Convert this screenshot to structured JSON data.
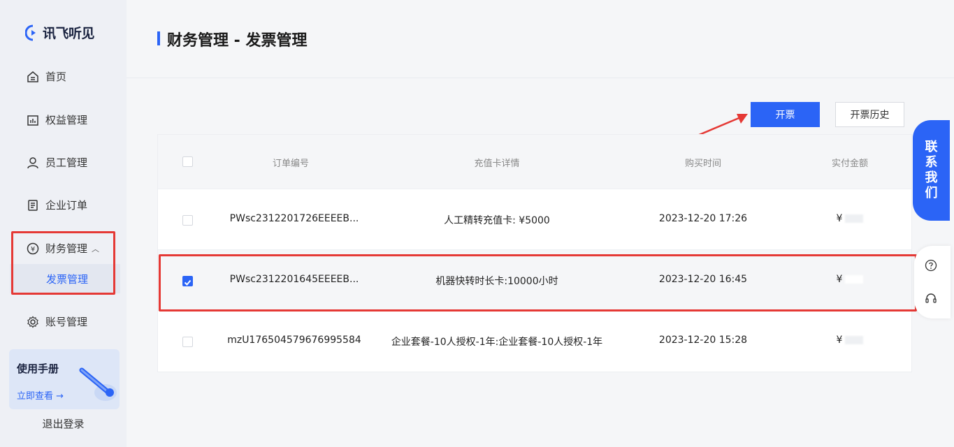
{
  "brand": {
    "logo_text": "讯飞听见"
  },
  "sidebar": {
    "items": [
      {
        "label": "首页"
      },
      {
        "label": "权益管理"
      },
      {
        "label": "员工管理"
      },
      {
        "label": "企业订单"
      },
      {
        "label": "财务管理"
      },
      {
        "label": "账号管理"
      }
    ],
    "sub_item": "发票管理",
    "manual_title": "使用手册",
    "manual_link": "立即查看 →",
    "logout": "退出登录"
  },
  "header": {
    "title": "财务管理 - 发票管理"
  },
  "actions": {
    "invoice": "开票",
    "history": "开票历史"
  },
  "table": {
    "columns": [
      "订单编号",
      "充值卡详情",
      "购买时间",
      "实付金额"
    ],
    "rows": [
      {
        "order_id": "PWsc2312201726EEEEB...",
        "detail": "人工精转充值卡: ¥5000",
        "time": "2023-12-20 17:26",
        "amount": "¥",
        "checked": false
      },
      {
        "order_id": "PWsc2312201645EEEEB...",
        "detail": "机器快转时长卡:10000小时",
        "time": "2023-12-20 16:45",
        "amount": "¥",
        "checked": true
      },
      {
        "order_id": "mzU176504579676995584",
        "detail": "企业套餐-10人授权-1年:企业套餐-10人授权-1年",
        "time": "2023-12-20 15:28",
        "amount": "¥",
        "checked": false
      }
    ]
  },
  "float": {
    "contact": [
      "联",
      "系",
      "我",
      "们"
    ]
  },
  "colors": {
    "accent": "#2b64f6",
    "highlight": "#e53935"
  }
}
